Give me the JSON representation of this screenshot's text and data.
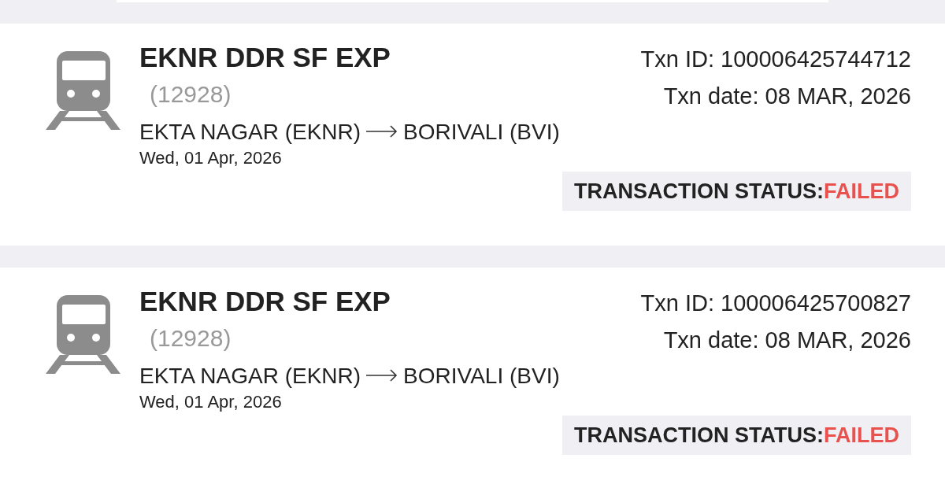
{
  "bookings": [
    {
      "train_name": "EKNR DDR SF EXP",
      "train_number": "(12928)",
      "from": "EKTA NAGAR (EKNR)",
      "to": "BORIVALI (BVI)",
      "journey_date": "Wed, 01 Apr, 2026",
      "txn_id": "Txn ID: 100006425744712",
      "txn_date": "Txn date: 08 MAR, 2026",
      "status_label": "TRANSACTION STATUS:",
      "status": {
        "text": "FAILED",
        "kind": "failed"
      }
    },
    {
      "train_name": "EKNR DDR SF EXP",
      "train_number": "(12928)",
      "from": "EKTA NAGAR (EKNR)",
      "to": "BORIVALI (BVI)",
      "journey_date": "Wed, 01 Apr, 2026",
      "txn_id": "Txn ID: 100006425700827",
      "txn_date": "Txn date: 08 MAR, 2026",
      "status_label": "TRANSACTION STATUS:",
      "status": {
        "text": "FAILED",
        "kind": "failed"
      }
    }
  ]
}
